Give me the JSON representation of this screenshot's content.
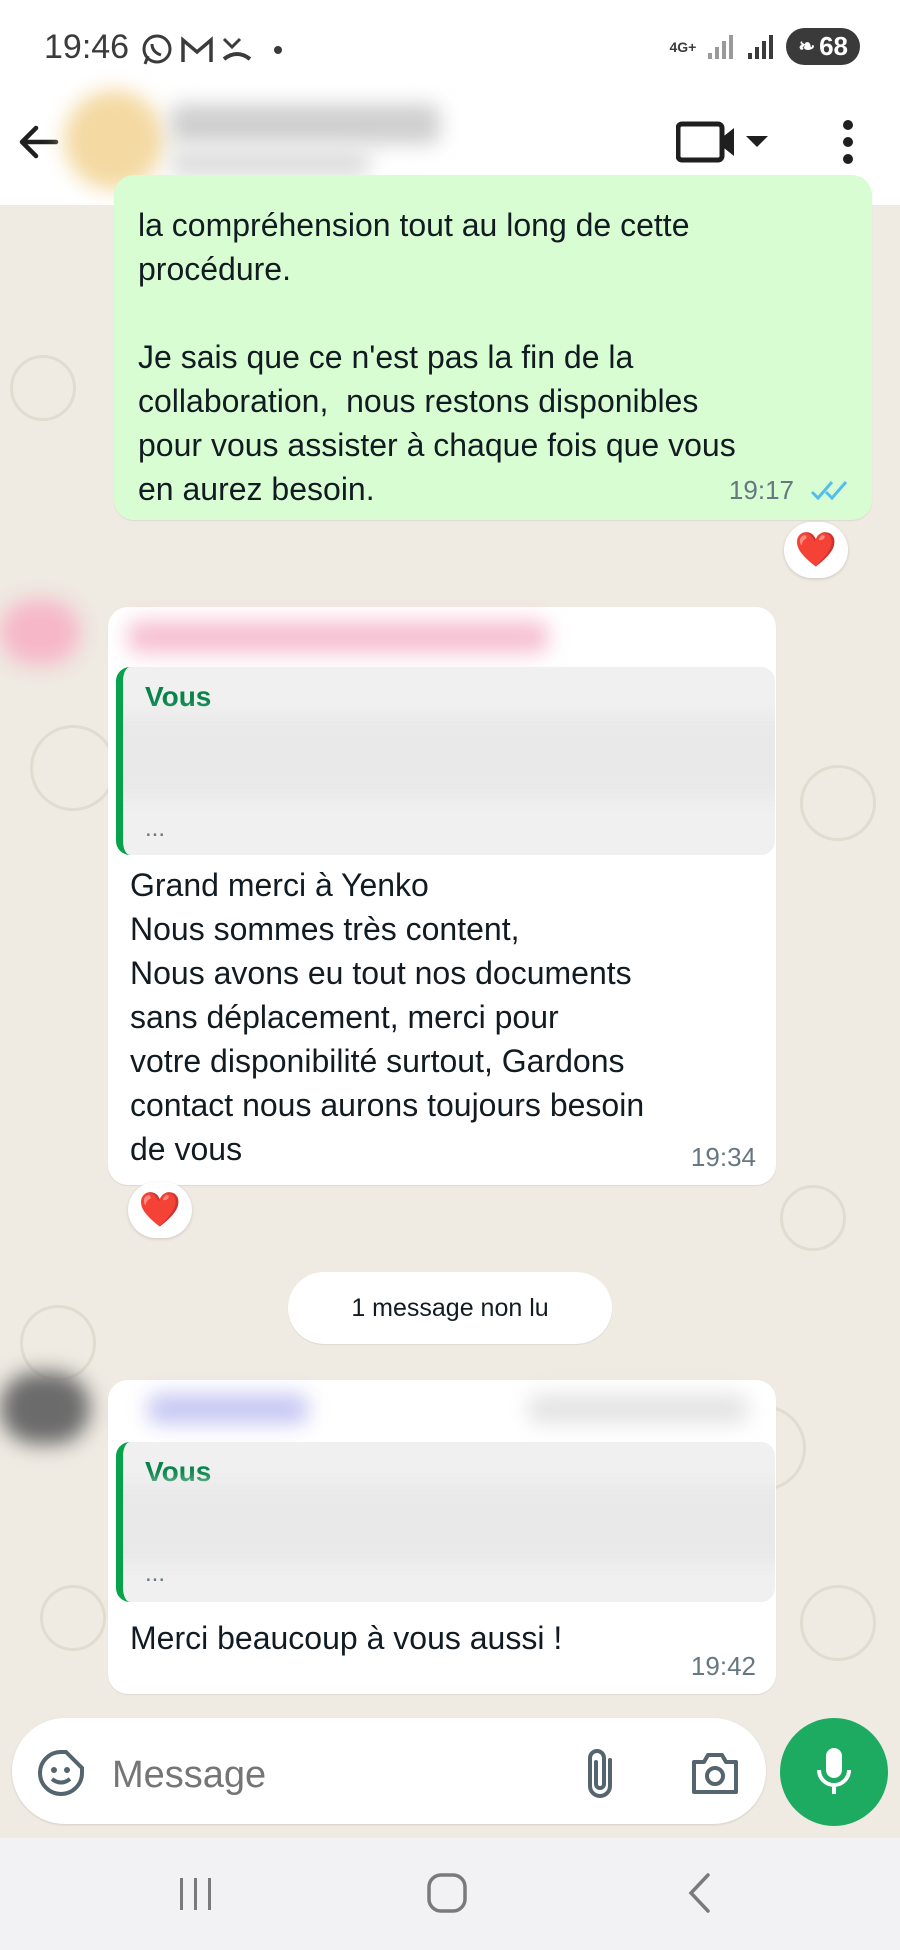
{
  "status_bar": {
    "time": "19:46",
    "network": "4G+",
    "battery": "68",
    "notification_icons": [
      "whatsapp-icon",
      "gmail-icon",
      "missed-call-icon",
      "dot-icon"
    ]
  },
  "header": {
    "icons": [
      "back-arrow-icon",
      "video-call-icon",
      "dropdown-icon",
      "more-vert-icon"
    ]
  },
  "messages": [
    {
      "direction": "outgoing",
      "text": "la compréhension tout au long de cette\nprocédure.\n\nJe sais que ce n'est pas la fin de la\ncollaboration,  nous restons disponibles\npour vous assister à chaque fois que vous\nen aurez besoin.",
      "time": "19:17",
      "status": "read",
      "reaction": "❤️"
    },
    {
      "direction": "incoming",
      "quote_author": "Vous",
      "quote_ellipsis": "...",
      "text": "Grand merci à Yenko\nNous sommes très content,\nNous avons eu tout nos documents\nsans déplacement, merci pour\nvotre disponibilité surtout, Gardons\ncontact nous aurons toujours besoin\nde vous",
      "time": "19:34",
      "reaction": "❤️"
    },
    {
      "direction": "incoming",
      "quote_author": "Vous",
      "quote_ellipsis": "...",
      "text": "Merci beaucoup à vous aussi !",
      "time": "19:42"
    }
  ],
  "unread_banner": "1 message non lu",
  "input": {
    "placeholder": "Message"
  },
  "colors": {
    "outgoing_bubble": "#d9fdd3",
    "incoming_bubble": "#ffffff",
    "chat_background": "#efeae2",
    "accent_green": "#1daa61",
    "read_ticks": "#53bdeb",
    "heart": "#e0242f"
  }
}
